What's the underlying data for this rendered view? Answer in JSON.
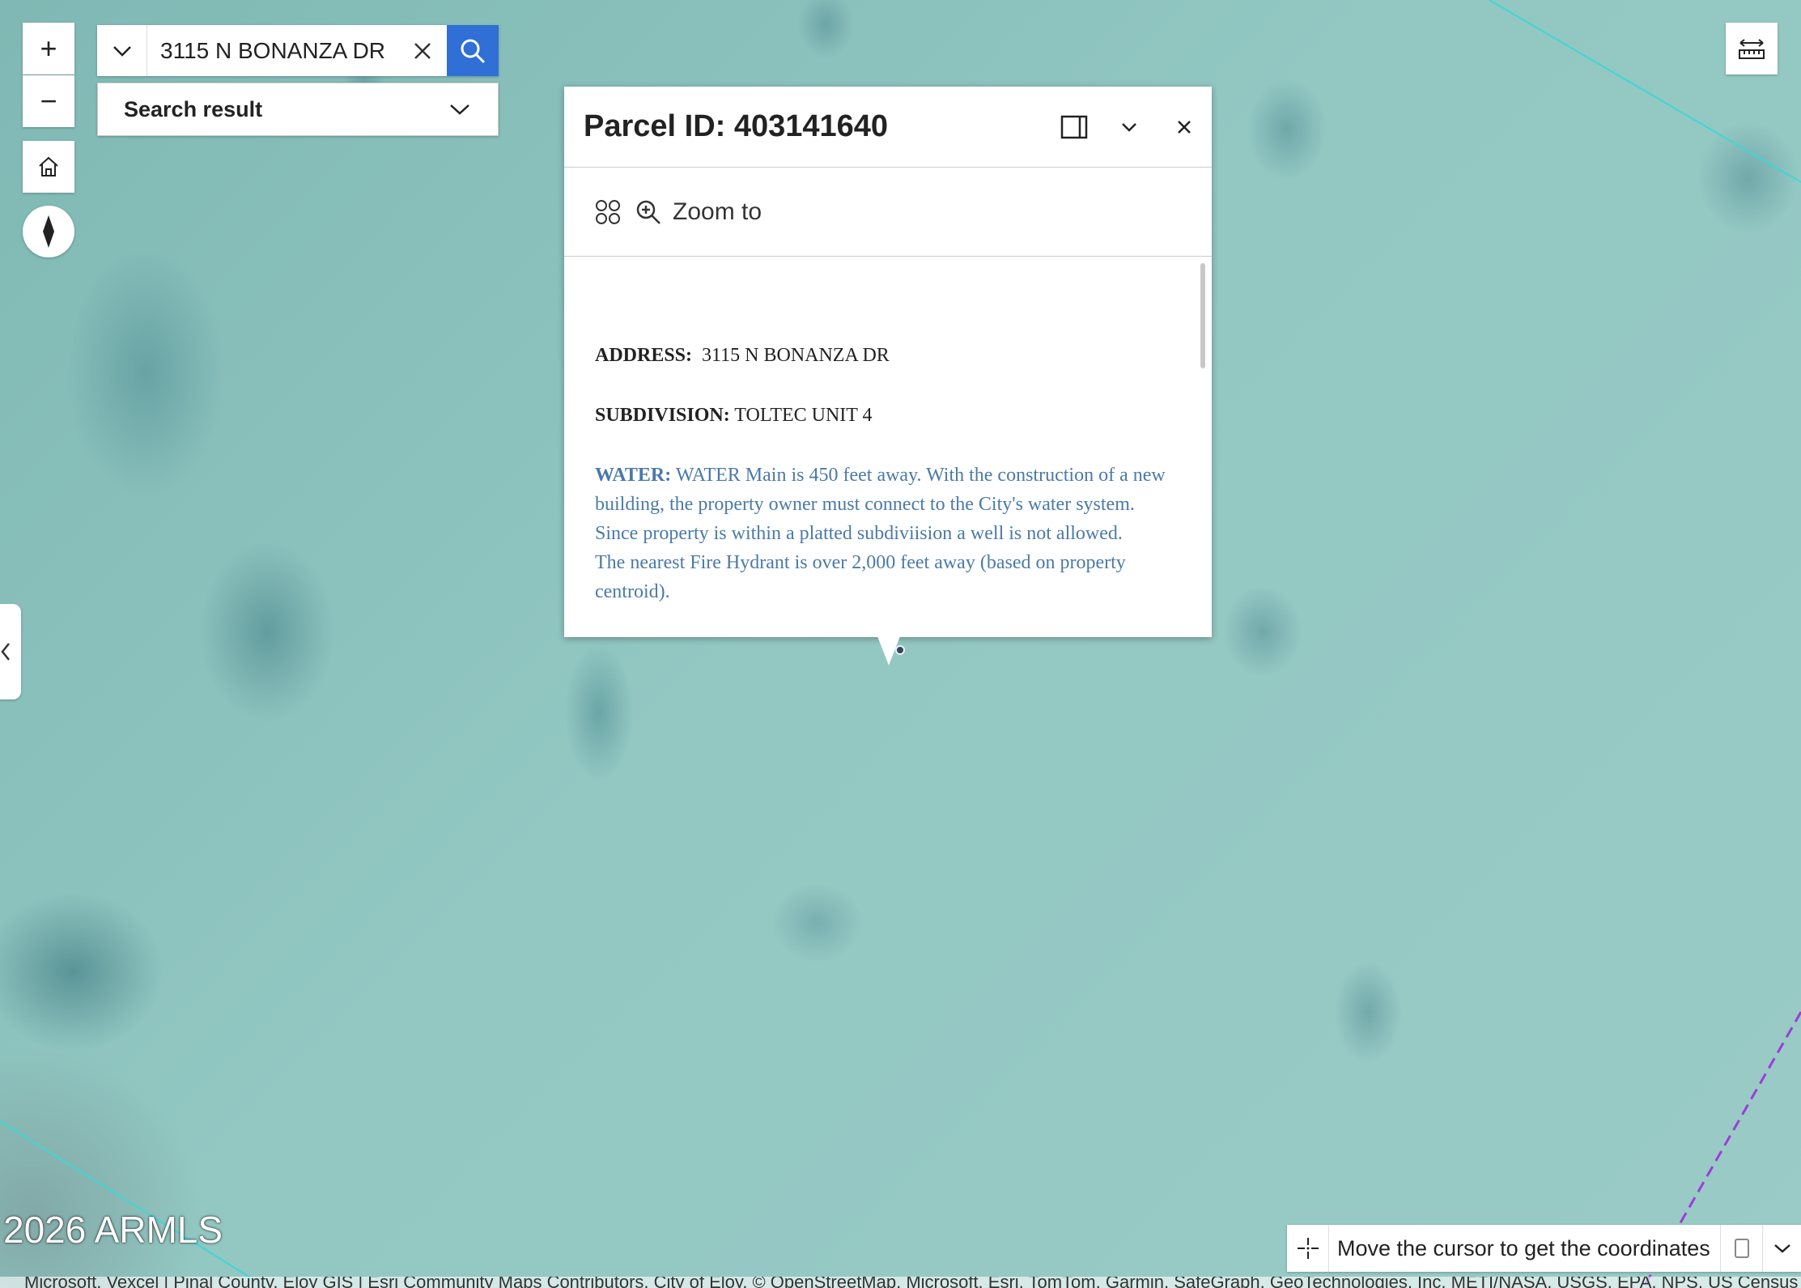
{
  "controls": {
    "zoom_in_label": "+",
    "zoom_out_label": "−"
  },
  "search": {
    "value": "3115 N BONANZA DR",
    "result_label": "Search result"
  },
  "popup": {
    "title": "Parcel ID: 403141640",
    "zoom_to_label": "Zoom to",
    "address_label": "ADDRESS:",
    "address_value": "3115 N BONANZA DR",
    "subdivision_label": "SUBDIVISION:",
    "subdivision_value": "TOLTEC UNIT 4",
    "water_label": "WATER:",
    "water_line1": "WATER Main is 450 feet away. With the construction of a new building, the property owner must connect to the City's water system.",
    "water_line2": "Since property is within a platted subdiviision a well is not allowed.",
    "water_line3": "The nearest Fire Hydrant is over 2,000 feet away (based on property centroid)."
  },
  "map": {
    "copyright": "2026 ARMLS",
    "attribution": "Microsoft, Vexcel | Pinal County, Eloy GIS | Esri Community Maps Contributors, City of Eloy, © OpenStreetMap, Microsoft, Esri, TomTom, Garmin, SafeGraph, GeoTechnologies, Inc, METI/NASA, USGS, EPA, NPS, US Census Bureau, USDA, USFWS | Powered by Esri",
    "coordinates_prompt": "Move the cursor to get the coordinates",
    "parcel_line_color": "#3fd6d6",
    "boundary_line_color": "#9a3fd6",
    "search_button_color": "#2f6fd6"
  }
}
